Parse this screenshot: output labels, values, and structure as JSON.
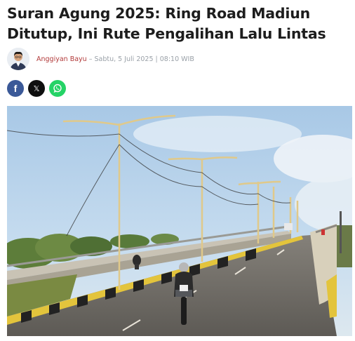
{
  "article": {
    "title": "Suran Agung 2025: Ring Road Madiun Ditutup, Ini Rute Pengalihan Lalu Lintas",
    "author": "Anggiyan Bayu",
    "separator": " – ",
    "date": "Sabtu, 5 Juli 2025 | 08:10 WIB"
  },
  "share": {
    "facebook_icon": "f",
    "x_icon": "𝕏",
    "whatsapp_icon": "whatsapp-icon"
  },
  "photo": {
    "subject": "flyover-road-with-street-lamps"
  },
  "colors": {
    "author": "#b23a3a",
    "facebook": "#3b5998",
    "x": "#0f0f0f",
    "whatsapp": "#25d366"
  }
}
